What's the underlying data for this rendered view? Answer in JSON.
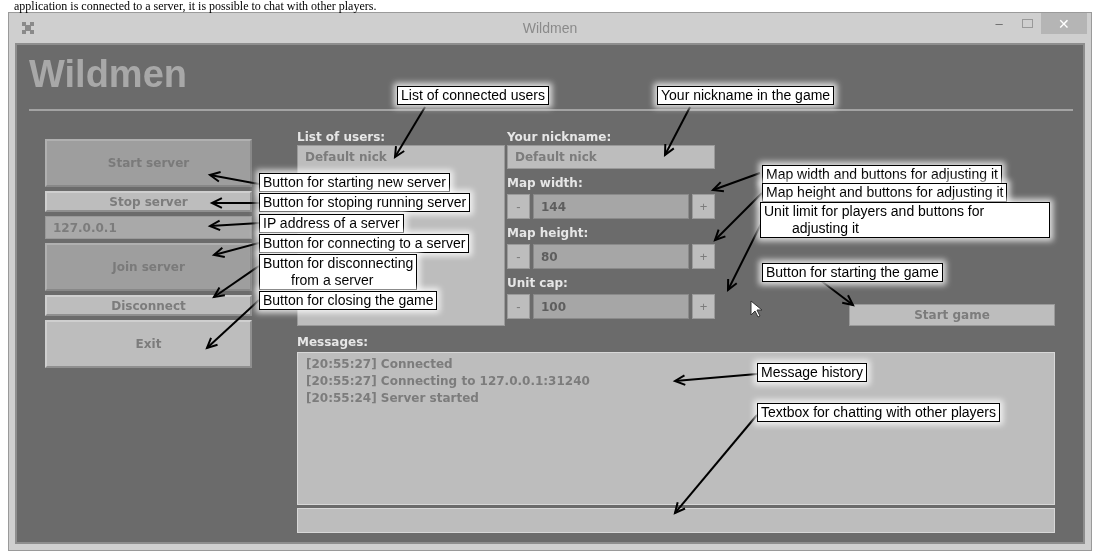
{
  "caption_fragment": "application is connected to a server, it is possible to chat with other players.",
  "window": {
    "title": "Wildmen",
    "minimize": "–",
    "close": "✕"
  },
  "app_title": "Wildmen",
  "side_buttons": [
    {
      "label": "Start server",
      "kind": "large",
      "disabled": true
    },
    {
      "label": "Stop server",
      "kind": "small",
      "disabled": false
    },
    {
      "label": "127.0.0.1",
      "kind": "field",
      "disabled": true
    },
    {
      "label": "Join server",
      "kind": "large",
      "disabled": true
    },
    {
      "label": "Disconnect",
      "kind": "small",
      "disabled": false
    },
    {
      "label": "Exit",
      "kind": "large",
      "disabled": false
    }
  ],
  "users": {
    "label": "List of users:",
    "items": [
      "Default nick"
    ]
  },
  "nickname": {
    "label": "Your nickname:",
    "value": "Default nick"
  },
  "spinners": [
    {
      "label": "Map width:",
      "value": "144",
      "minus": "-",
      "plus": "+"
    },
    {
      "label": "Map height:",
      "value": "80",
      "minus": "-",
      "plus": "+"
    },
    {
      "label": "Unit cap:",
      "value": "100",
      "minus": "-",
      "plus": "+"
    }
  ],
  "start_game": "Start game",
  "messages": {
    "label": "Messages:",
    "items": [
      "[20:55:27] Connected",
      "[20:55:27] Connecting to 127.0.0.1:31240",
      "[20:55:24] Server started"
    ]
  },
  "annotations": [
    {
      "lines": [
        "List of connected users"
      ]
    },
    {
      "lines": [
        "Your nickname in the game"
      ]
    },
    {
      "lines": [
        "Button for starting new server"
      ]
    },
    {
      "lines": [
        "Button for stoping running server"
      ]
    },
    {
      "lines": [
        "IP address of a server"
      ]
    },
    {
      "lines": [
        "Button for connecting to a server"
      ]
    },
    {
      "lines": [
        "Button for disconnecting",
        "from a server"
      ]
    },
    {
      "lines": [
        "Button for closing the game"
      ]
    },
    {
      "lines": [
        "Map width and buttons for adjusting it"
      ]
    },
    {
      "lines": [
        "Map height and buttons for adjusting it"
      ]
    },
    {
      "lines": [
        "Unit limit for players and buttons for",
        "adjusting it"
      ]
    },
    {
      "lines": [
        "Button for starting the game"
      ]
    },
    {
      "lines": [
        "Message history"
      ]
    },
    {
      "lines": [
        "Textbox for chatting with other players"
      ]
    }
  ]
}
